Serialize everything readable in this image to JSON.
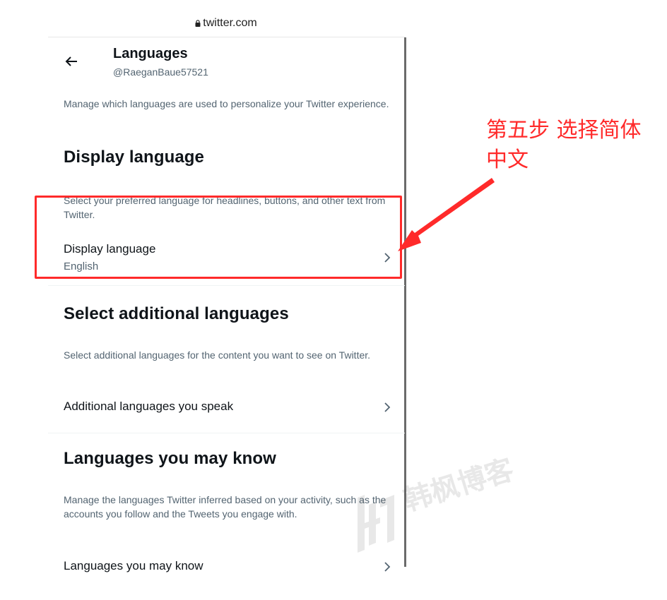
{
  "browser": {
    "url": "twitter.com"
  },
  "header": {
    "title": "Languages",
    "handle": "@RaeganBaue57521"
  },
  "intro": "Manage which languages are used to personalize your Twitter experience.",
  "display_language_section": {
    "heading": "Display language",
    "description": "Select your preferred language for headlines, buttons, and other text from Twitter.",
    "row_label": "Display language",
    "row_value": "English"
  },
  "additional_section": {
    "heading": "Select additional languages",
    "description": "Select additional languages for the content you want to see on Twitter.",
    "row_label": "Additional languages you speak"
  },
  "may_know_section": {
    "heading": "Languages you may know",
    "description": "Manage the languages Twitter inferred based on your activity, such as the accounts you follow and the Tweets you engage with.",
    "row_label": "Languages you may know"
  },
  "annotation": {
    "text": "第五步 选择简体中文",
    "color": "#ff2a2a"
  },
  "watermark": {
    "text": "韩枫博客"
  },
  "icons": {
    "back": "arrow-left-icon",
    "chevron": "chevron-right-icon",
    "lock": "lock-icon"
  },
  "colors": {
    "text_primary": "#0f1419",
    "text_secondary": "#536471",
    "annotation": "#ff2a2a"
  }
}
